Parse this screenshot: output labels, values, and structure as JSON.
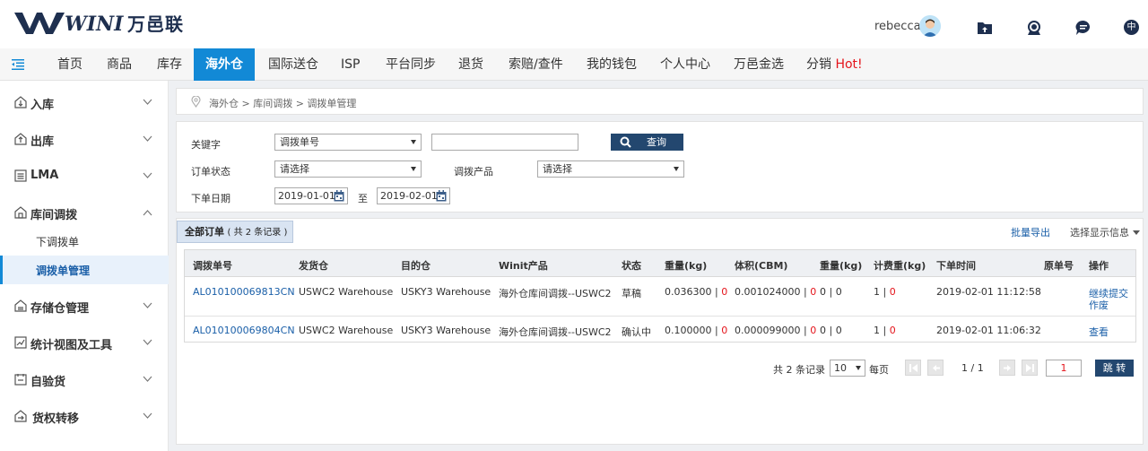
{
  "brand": {
    "logo_text": "WINIT",
    "logo_cn": "万邑联"
  },
  "header": {
    "username": "rebecca",
    "lang": "中"
  },
  "nav": {
    "items": [
      {
        "label": "首页"
      },
      {
        "label": "商品"
      },
      {
        "label": "库存"
      },
      {
        "label": "海外仓"
      },
      {
        "label": "国际送仓"
      },
      {
        "label": "ISP"
      },
      {
        "label": "平台同步"
      },
      {
        "label": "退货"
      },
      {
        "label": "索赔/查件"
      },
      {
        "label": "我的钱包"
      },
      {
        "label": "个人中心"
      },
      {
        "label": "万邑金选"
      },
      {
        "label": "分销",
        "hot": "Hot!"
      }
    ],
    "active": "海外仓"
  },
  "sidebar": {
    "items": [
      {
        "label": "入库"
      },
      {
        "label": "出库"
      },
      {
        "label": "LMA"
      },
      {
        "label": "库间调拨"
      },
      {
        "label": "存储仓管理"
      },
      {
        "label": "统计视图及工具"
      },
      {
        "label": "自验货"
      },
      {
        "label": "货权转移"
      }
    ],
    "subitems": [
      {
        "label": "下调拨单"
      },
      {
        "label": "调拨单管理"
      }
    ]
  },
  "breadcrumb": "海外仓 > 库间调拨 > 调拨单管理",
  "filter": {
    "keyword_label": "关键字",
    "keyword_type": "调拨单号",
    "keyword_value": "",
    "search_label": "查询",
    "status_label": "订单状态",
    "status_value": "请选择",
    "product_label": "调拨产品",
    "product_value": "请选择",
    "date_label": "下单日期",
    "date_from": "2019-01-01",
    "date_to_label": "至",
    "date_to": "2019-02-01"
  },
  "panel": {
    "tab_label": "全部订单",
    "tab_count": "( 共 2 条记录 )",
    "export_label": "批量导出",
    "columns_label": "选择显示信息"
  },
  "table": {
    "headers": [
      "调拨单号",
      "发货仓",
      "目的仓",
      "Winit产品",
      "状态",
      "重量(kg)",
      "体积(CBM)",
      "重量(kg)",
      "计费重(kg)",
      "下单时间",
      "原单号",
      "操作"
    ],
    "rows": [
      {
        "id": "AL010100069813CN",
        "from": "USWC2 Warehouse",
        "to": "USKY3 Warehouse",
        "product": "海外仓库间调拨--USWC2",
        "status": "草稿",
        "weight": "0.036300",
        "weight_b": "0",
        "volume": "0.001024000",
        "volume_b": "0",
        "weight2": "0",
        "weight2_b": "0",
        "charge": "1",
        "charge_b": "0",
        "time": "2019-02-01 11:12:58",
        "orig": "",
        "actions": [
          "继续提交",
          "作废"
        ]
      },
      {
        "id": "AL010100069804CN",
        "from": "USWC2 Warehouse",
        "to": "USKY3 Warehouse",
        "product": "海外仓库间调拨--USWC2",
        "status": "确认中",
        "weight": "0.100000",
        "weight_b": "0",
        "volume": "0.000099000",
        "volume_b": "0",
        "weight2": "0",
        "weight2_b": "0",
        "charge": "1",
        "charge_b": "0",
        "time": "2019-02-01 11:06:32",
        "orig": "",
        "actions": [
          "查看"
        ]
      }
    ]
  },
  "pager": {
    "total": "共 2 条记录",
    "page_size": "10",
    "per_page": "每页",
    "page_info": "1 / 1",
    "page_input": "1",
    "jump_label": "跳 转"
  },
  "colors": {
    "primary": "#1289d6",
    "dark_button": "#23476f",
    "link": "#1a5fa8",
    "hot": "#e4141b"
  }
}
